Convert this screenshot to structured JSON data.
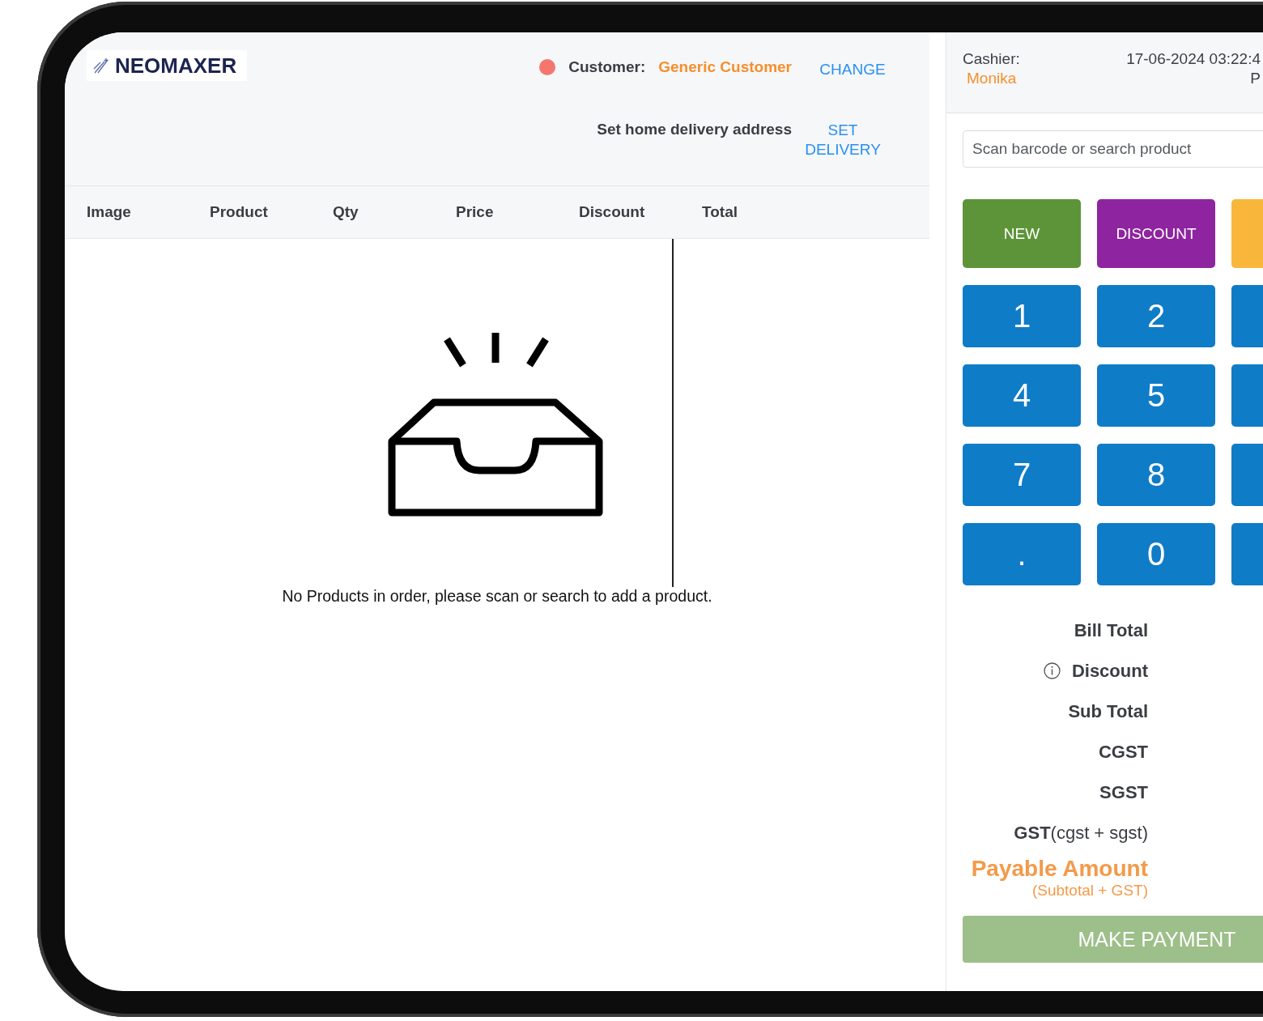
{
  "header": {
    "logo": "NEOMAXER",
    "customer_label": "Customer:",
    "customer_name": "Generic Customer",
    "change_button": "CHANGE",
    "delivery_label": "Set home delivery address",
    "delivery_button": "SET DELIVERY"
  },
  "table": {
    "columns": [
      "Image",
      "Product",
      "Qty",
      "Price",
      "Discount",
      "Total"
    ],
    "empty_message": "No Products in order, please scan or search to add a product."
  },
  "cashier": {
    "label": "Cashier:",
    "name": "Monika",
    "date_time": "17-06-2024 03:22:4",
    "time_suffix": "P"
  },
  "search": {
    "placeholder": "Scan barcode or search product"
  },
  "action_buttons": [
    {
      "label": "NEW",
      "color": "#5e9439"
    },
    {
      "label": "DISCOUNT",
      "color": "#8e24a0"
    },
    {
      "color": "#f8b73b"
    }
  ],
  "keypad": [
    [
      "1",
      "2"
    ],
    [
      "4",
      "5"
    ],
    [
      "7",
      "8"
    ],
    [
      ".",
      "0"
    ]
  ],
  "totals": [
    {
      "label": "Bill Total",
      "kind": "plain"
    },
    {
      "label": "Discount",
      "kind": "info"
    },
    {
      "label": "Sub Total",
      "kind": "plain"
    },
    {
      "label": "CGST",
      "kind": "plain"
    },
    {
      "label": "SGST",
      "kind": "plain"
    },
    {
      "label": "**GST**(cgst + sgst)",
      "kind": "mixed"
    }
  ],
  "payable": {
    "label": "Payable Amount",
    "note": "(Subtotal + GST)"
  },
  "payment_button": "MAKE PAYMENT"
}
